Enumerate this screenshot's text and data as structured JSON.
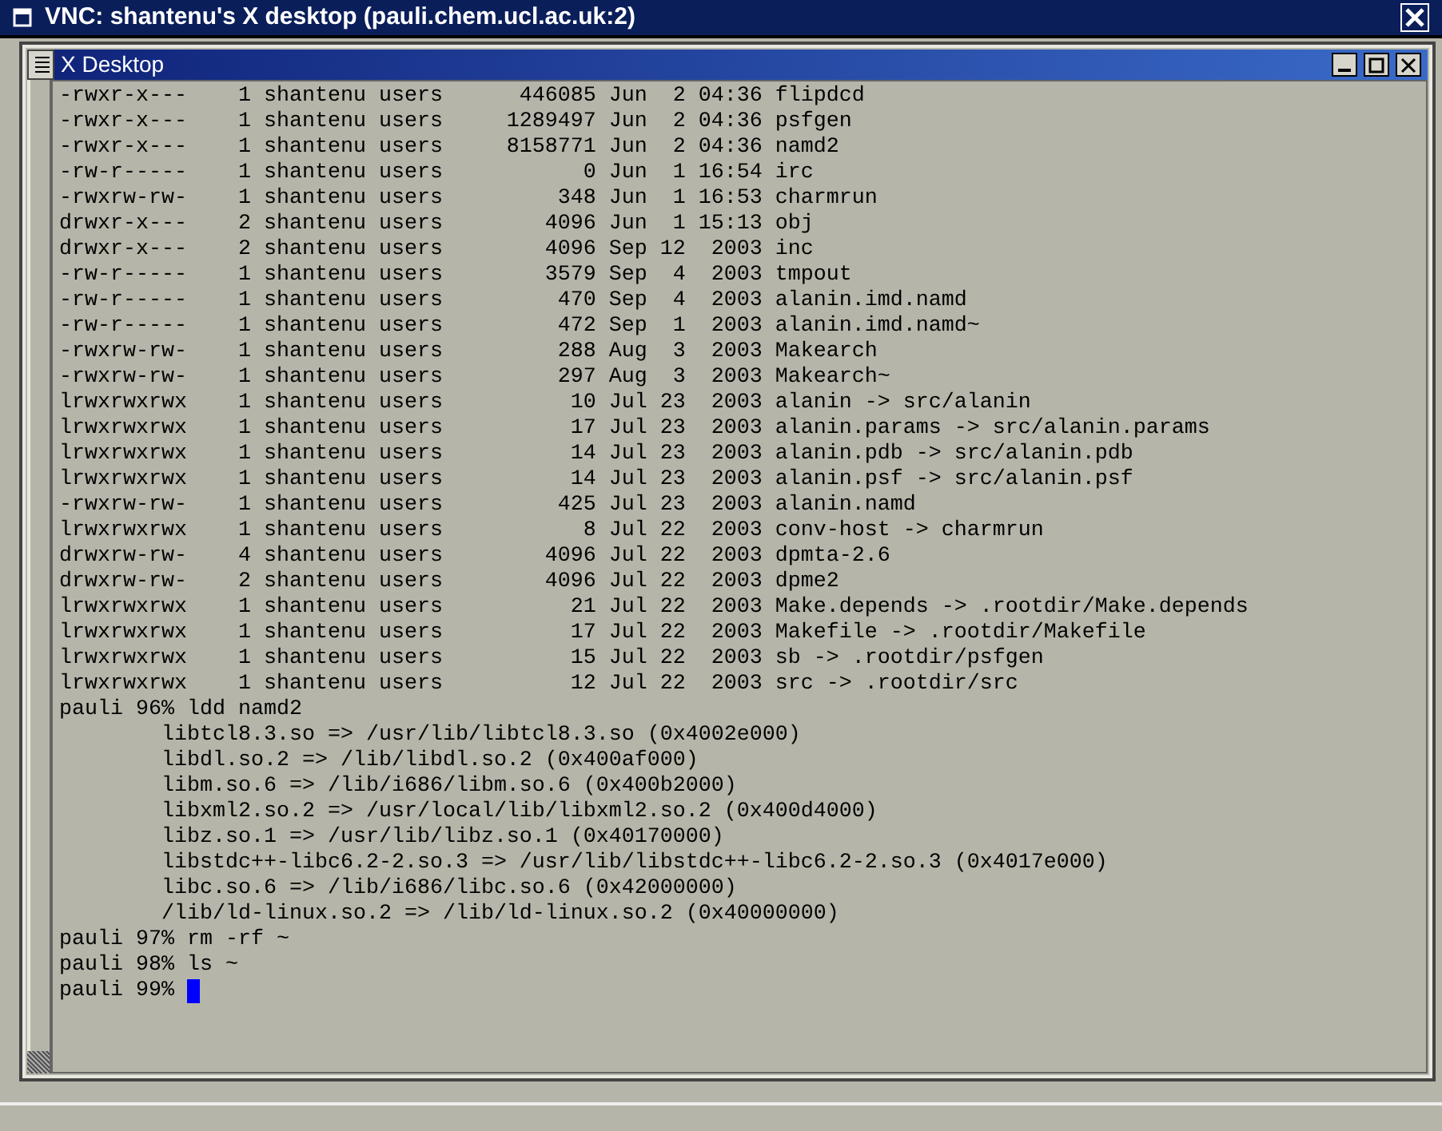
{
  "window": {
    "title": "VNC: shantenu's X desktop (pauli.chem.ucl.ac.uk:2)"
  },
  "inner_window": {
    "title": "X Desktop"
  },
  "terminal": {
    "lines": [
      "-rwxr-x---    1 shantenu users      446085 Jun  2 04:36 flipdcd",
      "-rwxr-x---    1 shantenu users     1289497 Jun  2 04:36 psfgen",
      "-rwxr-x---    1 shantenu users     8158771 Jun  2 04:36 namd2",
      "-rw-r-----    1 shantenu users           0 Jun  1 16:54 irc",
      "-rwxrw-rw-    1 shantenu users         348 Jun  1 16:53 charmrun",
      "drwxr-x---    2 shantenu users        4096 Jun  1 15:13 obj",
      "drwxr-x---    2 shantenu users        4096 Sep 12  2003 inc",
      "-rw-r-----    1 shantenu users        3579 Sep  4  2003 tmpout",
      "-rw-r-----    1 shantenu users         470 Sep  4  2003 alanin.imd.namd",
      "-rw-r-----    1 shantenu users         472 Sep  1  2003 alanin.imd.namd~",
      "-rwxrw-rw-    1 shantenu users         288 Aug  3  2003 Makearch",
      "-rwxrw-rw-    1 shantenu users         297 Aug  3  2003 Makearch~",
      "lrwxrwxrwx    1 shantenu users          10 Jul 23  2003 alanin -> src/alanin",
      "lrwxrwxrwx    1 shantenu users          17 Jul 23  2003 alanin.params -> src/alanin.params",
      "lrwxrwxrwx    1 shantenu users          14 Jul 23  2003 alanin.pdb -> src/alanin.pdb",
      "lrwxrwxrwx    1 shantenu users          14 Jul 23  2003 alanin.psf -> src/alanin.psf",
      "-rwxrw-rw-    1 shantenu users         425 Jul 23  2003 alanin.namd",
      "lrwxrwxrwx    1 shantenu users           8 Jul 22  2003 conv-host -> charmrun",
      "drwxrw-rw-    4 shantenu users        4096 Jul 22  2003 dpmta-2.6",
      "drwxrw-rw-    2 shantenu users        4096 Jul 22  2003 dpme2",
      "lrwxrwxrwx    1 shantenu users          21 Jul 22  2003 Make.depends -> .rootdir/Make.depends",
      "lrwxrwxrwx    1 shantenu users          17 Jul 22  2003 Makefile -> .rootdir/Makefile",
      "lrwxrwxrwx    1 shantenu users          15 Jul 22  2003 sb -> .rootdir/psfgen",
      "lrwxrwxrwx    1 shantenu users          12 Jul 22  2003 src -> .rootdir/src",
      "pauli 96% ldd namd2",
      "        libtcl8.3.so => /usr/lib/libtcl8.3.so (0x4002e000)",
      "        libdl.so.2 => /lib/libdl.so.2 (0x400af000)",
      "        libm.so.6 => /lib/i686/libm.so.6 (0x400b2000)",
      "        libxml2.so.2 => /usr/local/lib/libxml2.so.2 (0x400d4000)",
      "        libz.so.1 => /usr/lib/libz.so.1 (0x40170000)",
      "        libstdc++-libc6.2-2.so.3 => /usr/lib/libstdc++-libc6.2-2.so.3 (0x4017e000)",
      "        libc.so.6 => /lib/i686/libc.so.6 (0x42000000)",
      "        /lib/ld-linux.so.2 => /lib/ld-linux.so.2 (0x40000000)",
      "pauli 97% rm -rf ~",
      "pauli 98% ls ~",
      "pauli 99% "
    ],
    "cursor_visible": true
  }
}
